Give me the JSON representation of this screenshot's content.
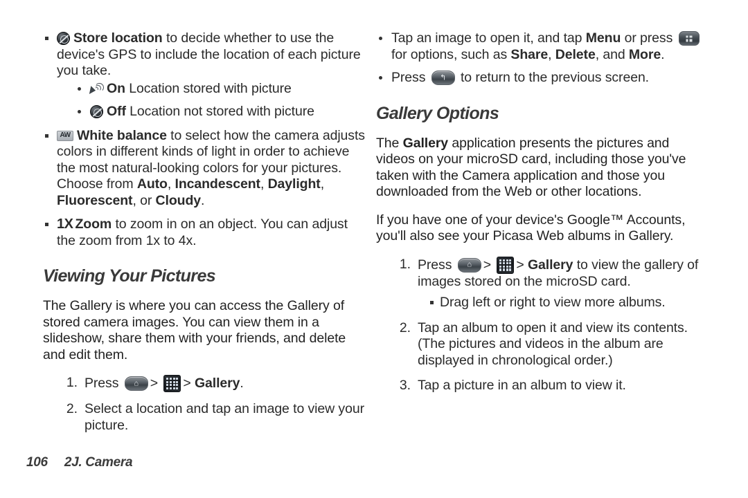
{
  "footer": {
    "page_number": "106",
    "chapter": "2J. Camera"
  },
  "left_column": {
    "camera_options": [
      {
        "icon": "store-location-icon",
        "bold_label": "Store location",
        "text_after": " to decide whether to use the device's GPS to include the location of each picture you take.",
        "sub_options": [
          {
            "icon": "gps-on-icon",
            "bold_label": "On",
            "text_after": " Location stored with picture"
          },
          {
            "icon": "gps-off-icon",
            "bold_label": "Off",
            "text_after": " Location not stored with picture"
          }
        ]
      },
      {
        "icon": "auto-white-balance-icon",
        "bold_label": "White balance",
        "text_after": " to select how the camera adjusts colors in different kinds of light in order to achieve the most natural-looking colors for your pictures. Choose from ",
        "choices": [
          "Auto",
          "Incandescent",
          "Daylight",
          "Fluorescent",
          "Cloudy"
        ],
        "choices_sep1": ", ",
        "choices_sep_last": ", or ",
        "text_end": "."
      },
      {
        "icon": "zoom-1x-icon",
        "zoom_prefix": "1X",
        "bold_label": "Zoom",
        "text_after": " to zoom in on an object. You can adjust the zoom from 1x to 4x."
      }
    ],
    "section": {
      "heading": "Viewing Your Pictures",
      "paragraph": "The Gallery is where you can access the Gallery of stored camera images. You can view them in a slideshow, share them with your friends, and delete and edit them.",
      "steps": [
        {
          "num": "1.",
          "press_label": "Press",
          "sep": ">",
          "sep2": ">",
          "target": "Gallery",
          "period": "."
        },
        {
          "num": "2.",
          "text": "Select a location and tap an image to view your picture."
        }
      ]
    }
  },
  "right_column": {
    "top_bullets": [
      {
        "text_part1": "Tap an image to open it, and tap ",
        "bold1": "Menu",
        "text_part2": " or press ",
        "icon": "menu-key-icon",
        "text_part3": " for options, such as ",
        "bold2": "Share",
        "sep2": ", ",
        "bold3": "Delete",
        "sep3": ", and ",
        "bold4": "More",
        "text_end": "."
      },
      {
        "text_part1": "Press ",
        "icon": "back-key-icon",
        "text_part2": " to return to the previous screen."
      }
    ],
    "section": {
      "heading": "Gallery Options",
      "paragraph1_pre": "The ",
      "paragraph1_bold": "Gallery",
      "paragraph1_post": " application presents the pictures and videos on your microSD card, including those you've taken with the Camera application and those you downloaded from the Web or other locations.",
      "paragraph2": "If you have one of your device's Google™ Accounts, you'll also see your Picasa Web albums in Gallery.",
      "steps": [
        {
          "num": "1.",
          "press_label": "Press",
          "sep": ">",
          "sep2": ">",
          "target": "Gallery",
          "text_after": " to view the gallery of images stored on the microSD card.",
          "sub_bullet": "Drag left or right to view more albums."
        },
        {
          "num": "2.",
          "text": "Tap an album to open it and view its contents. (The pictures and videos in the album are displayed in chronological order.)"
        },
        {
          "num": "3.",
          "text": "Tap a picture in an album to view it."
        }
      ]
    }
  }
}
